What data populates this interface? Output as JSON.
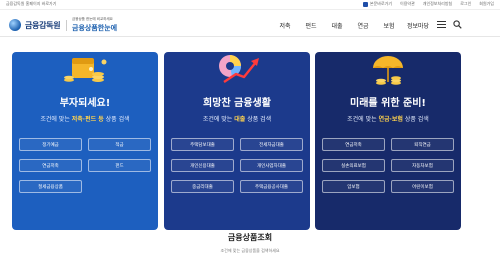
{
  "topbar": {
    "left_link": "금융감독원 홈페이지 바로가기",
    "util_items": [
      "본문바로가기",
      "이용약관",
      "개인정보처리방침",
      "로그인",
      "회원가입"
    ]
  },
  "header": {
    "org_name": "금융감독원",
    "brand_sub": "금융상품 한눈에 비교하세요",
    "brand_main": "금융상품한눈에",
    "nav": [
      "저축",
      "펀드",
      "대출",
      "연금",
      "보험",
      "정보마당"
    ]
  },
  "cards": [
    {
      "title": "부자되세요!",
      "desc_prefix": "조건에 맞는 ",
      "desc_highlight": "저축·펀드 등",
      "desc_suffix": " 상품 검색",
      "buttons": [
        "정기예금",
        "적금",
        "연금저축",
        "펀드",
        "절세금융상품"
      ]
    },
    {
      "title": "희망찬 금융생활",
      "desc_prefix": "조건에 맞는 ",
      "desc_highlight": "대출",
      "desc_suffix": " 상품 검색",
      "buttons": [
        "주택담보대출",
        "전세자금대출",
        "개인신용대출",
        "개인사업자대출",
        "중금리대출",
        "주택금융공사대출"
      ]
    },
    {
      "title": "미래를 위한 준비!",
      "desc_prefix": "조건에 맞는 ",
      "desc_highlight": "연금·보험",
      "desc_suffix": " 상품 검색",
      "buttons": [
        "연금저축",
        "퇴직연금",
        "실손의료보험",
        "자동차보험",
        "암보험",
        "어린이보험"
      ]
    }
  ],
  "bottom": {
    "title": "금융상품조회",
    "subtitle": "조건에 맞는 금융상품을 검색하세요"
  },
  "colors": {
    "card1": "#1d5fbf",
    "card2": "#1c3a8c",
    "card3": "#172a6a",
    "highlight": "#ffd34d"
  }
}
